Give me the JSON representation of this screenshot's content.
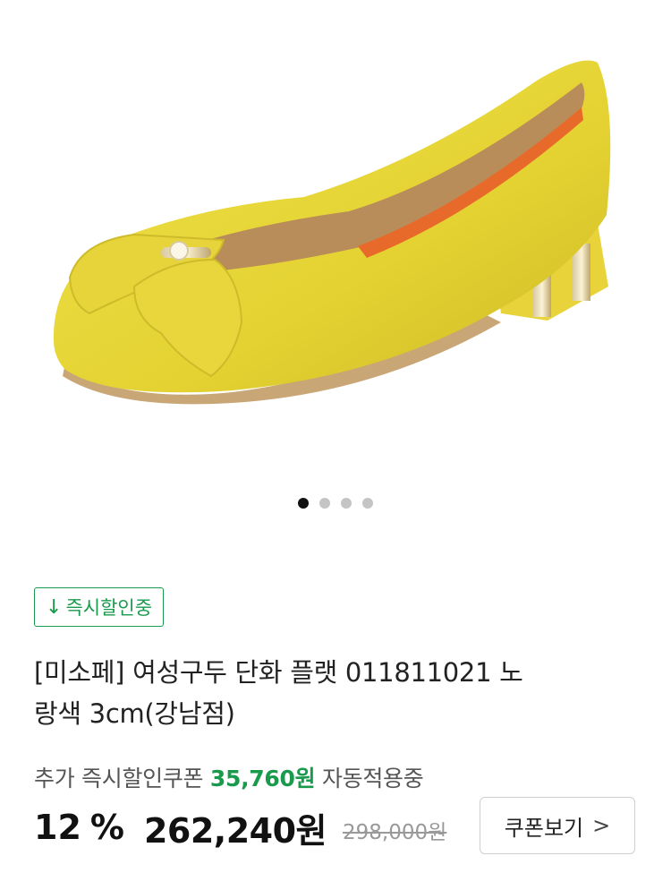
{
  "product": {
    "badge_label": "즉시할인중",
    "title_line1": "[미소페] 여성구두 단화 플랫 011811021 노",
    "title_line2": "랑색 3cm(강남점)"
  },
  "coupon": {
    "prefix": "추가 즉시할인쿠폰",
    "amount": "35,760원",
    "suffix": "자동적용중",
    "button_label": "쿠폰보기"
  },
  "price": {
    "discount_pct": "12",
    "pct_unit": "%",
    "sale_price": "262,240원",
    "original_price": "298,000원"
  },
  "carousel": {
    "count": 4,
    "active_index": 0
  },
  "colors": {
    "accent_green": "#1a9a4d",
    "shoe_yellow": "#e9d83a"
  },
  "icons": {
    "badge": "down-arrow-icon",
    "button": "chevron-right-icon"
  }
}
